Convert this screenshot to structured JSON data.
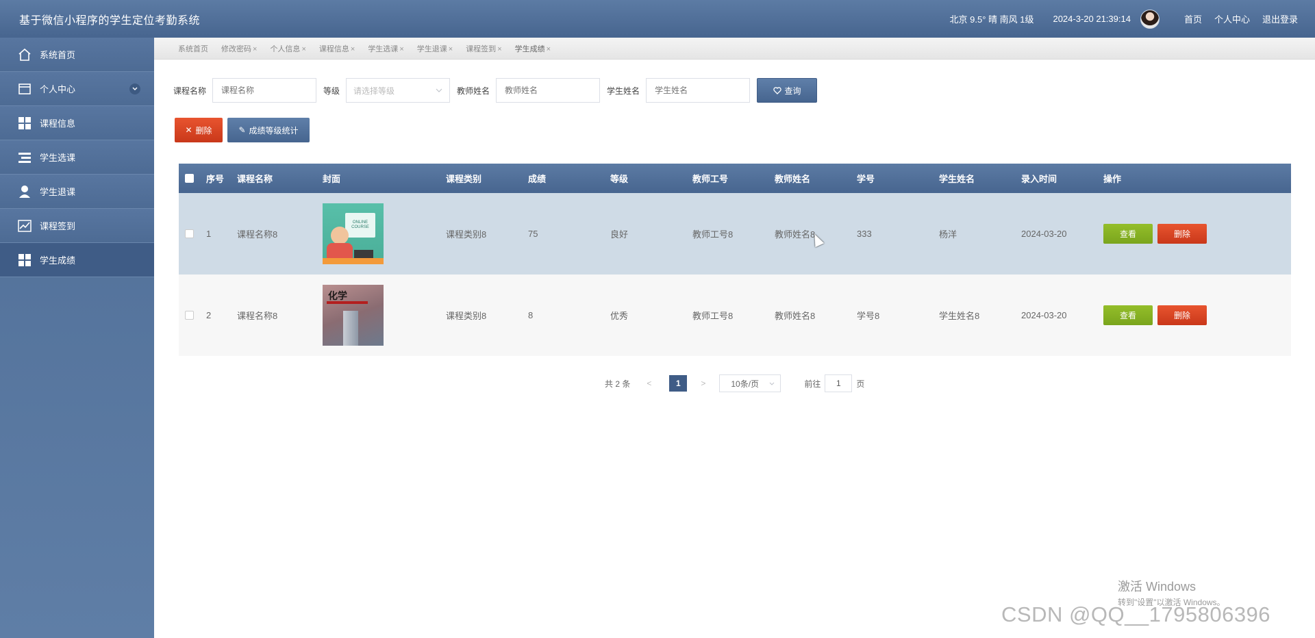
{
  "header": {
    "app_title": "基于微信小程序的学生定位考勤系统",
    "weather": "北京  9.5°  晴  南风  1级",
    "datetime": "2024-3-20 21:39:14",
    "links": [
      "首页",
      "个人中心",
      "退出登录"
    ]
  },
  "sidebar": {
    "items": [
      {
        "label": "系统首页",
        "icon": "home-icon"
      },
      {
        "label": "个人中心",
        "icon": "card-icon",
        "expandable": true
      },
      {
        "label": "课程信息",
        "icon": "grid-icon"
      },
      {
        "label": "学生选课",
        "icon": "list-icon"
      },
      {
        "label": "学生退课",
        "icon": "user-icon"
      },
      {
        "label": "课程签到",
        "icon": "chart-icon"
      },
      {
        "label": "学生成绩",
        "icon": "grid-icon",
        "active": true
      }
    ]
  },
  "tabs": [
    "系统首页",
    "修改密码",
    "个人信息",
    "课程信息",
    "学生选课",
    "学生退课",
    "课程签到",
    "学生成绩"
  ],
  "tab_close": "×",
  "filters": {
    "course_name_label": "课程名称",
    "course_name_placeholder": "课程名称",
    "grade_label": "等级",
    "grade_placeholder": "请选择等级",
    "teacher_name_label": "教师姓名",
    "teacher_name_placeholder": "教师姓名",
    "student_name_label": "学生姓名",
    "student_name_placeholder": "学生姓名",
    "query_button": "查询"
  },
  "actions": {
    "delete_button": "删除",
    "stat_button": "成绩等级统计"
  },
  "table": {
    "columns": [
      "序号",
      "课程名称",
      "封面",
      "课程类别",
      "成绩",
      "等级",
      "教师工号",
      "教师姓名",
      "学号",
      "学生姓名",
      "录入时间",
      "操作"
    ],
    "rows": [
      {
        "no": "1",
        "course": "课程名称8",
        "type": "课程类别8",
        "score": "75",
        "grade": "良好",
        "tno": "教师工号8",
        "tname": "教师姓名8",
        "sno": "333",
        "sname": "杨洋",
        "time": "2024-03-20",
        "cover_text": "ONLINE COURSE"
      },
      {
        "no": "2",
        "course": "课程名称8",
        "type": "课程类别8",
        "score": "8",
        "grade": "优秀",
        "tno": "教师工号8",
        "tname": "教师姓名8",
        "sno": "学号8",
        "sname": "学生姓名8",
        "time": "2024-03-20",
        "cover_text": "化学"
      }
    ],
    "view_button": "查看",
    "delete_button": "删除"
  },
  "pagination": {
    "total": "共 2 条",
    "prev": "<",
    "current_page": "1",
    "next": ">",
    "page_size": "10条/页",
    "goto_label": "前往",
    "goto_value": "1",
    "page_suffix": "页"
  },
  "watermark": {
    "line1": "激活 Windows",
    "line2": "转到\"设置\"以激活 Windows。",
    "csdn": "CSDN @QQ__1795806396"
  },
  "colors": {
    "primary": "#47658f",
    "danger": "#d9441f",
    "success": "#86b023",
    "row_highlight": "#cfdbe6"
  }
}
